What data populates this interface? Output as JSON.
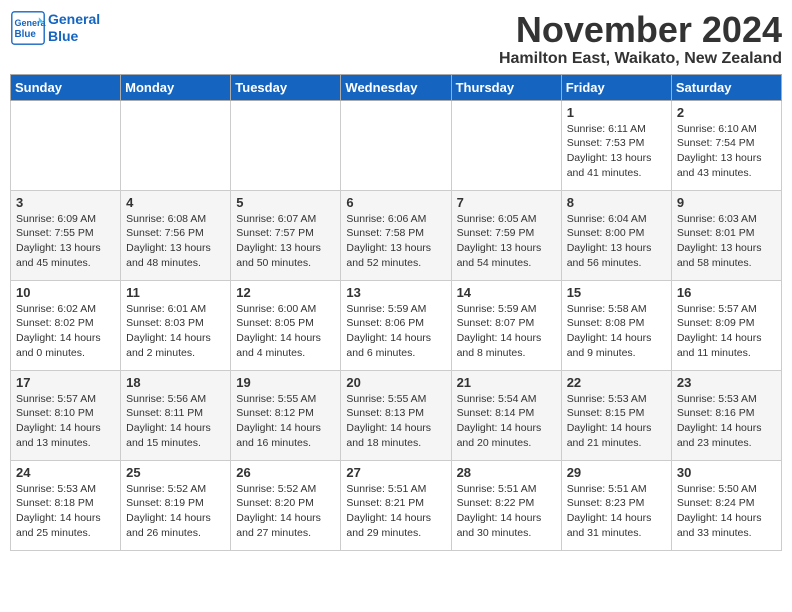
{
  "header": {
    "logo_line1": "General",
    "logo_line2": "Blue",
    "month": "November 2024",
    "location": "Hamilton East, Waikato, New Zealand"
  },
  "weekdays": [
    "Sunday",
    "Monday",
    "Tuesday",
    "Wednesday",
    "Thursday",
    "Friday",
    "Saturday"
  ],
  "weeks": [
    [
      {
        "day": "",
        "detail": ""
      },
      {
        "day": "",
        "detail": ""
      },
      {
        "day": "",
        "detail": ""
      },
      {
        "day": "",
        "detail": ""
      },
      {
        "day": "",
        "detail": ""
      },
      {
        "day": "1",
        "detail": "Sunrise: 6:11 AM\nSunset: 7:53 PM\nDaylight: 13 hours\nand 41 minutes."
      },
      {
        "day": "2",
        "detail": "Sunrise: 6:10 AM\nSunset: 7:54 PM\nDaylight: 13 hours\nand 43 minutes."
      }
    ],
    [
      {
        "day": "3",
        "detail": "Sunrise: 6:09 AM\nSunset: 7:55 PM\nDaylight: 13 hours\nand 45 minutes."
      },
      {
        "day": "4",
        "detail": "Sunrise: 6:08 AM\nSunset: 7:56 PM\nDaylight: 13 hours\nand 48 minutes."
      },
      {
        "day": "5",
        "detail": "Sunrise: 6:07 AM\nSunset: 7:57 PM\nDaylight: 13 hours\nand 50 minutes."
      },
      {
        "day": "6",
        "detail": "Sunrise: 6:06 AM\nSunset: 7:58 PM\nDaylight: 13 hours\nand 52 minutes."
      },
      {
        "day": "7",
        "detail": "Sunrise: 6:05 AM\nSunset: 7:59 PM\nDaylight: 13 hours\nand 54 minutes."
      },
      {
        "day": "8",
        "detail": "Sunrise: 6:04 AM\nSunset: 8:00 PM\nDaylight: 13 hours\nand 56 minutes."
      },
      {
        "day": "9",
        "detail": "Sunrise: 6:03 AM\nSunset: 8:01 PM\nDaylight: 13 hours\nand 58 minutes."
      }
    ],
    [
      {
        "day": "10",
        "detail": "Sunrise: 6:02 AM\nSunset: 8:02 PM\nDaylight: 14 hours\nand 0 minutes."
      },
      {
        "day": "11",
        "detail": "Sunrise: 6:01 AM\nSunset: 8:03 PM\nDaylight: 14 hours\nand 2 minutes."
      },
      {
        "day": "12",
        "detail": "Sunrise: 6:00 AM\nSunset: 8:05 PM\nDaylight: 14 hours\nand 4 minutes."
      },
      {
        "day": "13",
        "detail": "Sunrise: 5:59 AM\nSunset: 8:06 PM\nDaylight: 14 hours\nand 6 minutes."
      },
      {
        "day": "14",
        "detail": "Sunrise: 5:59 AM\nSunset: 8:07 PM\nDaylight: 14 hours\nand 8 minutes."
      },
      {
        "day": "15",
        "detail": "Sunrise: 5:58 AM\nSunset: 8:08 PM\nDaylight: 14 hours\nand 9 minutes."
      },
      {
        "day": "16",
        "detail": "Sunrise: 5:57 AM\nSunset: 8:09 PM\nDaylight: 14 hours\nand 11 minutes."
      }
    ],
    [
      {
        "day": "17",
        "detail": "Sunrise: 5:57 AM\nSunset: 8:10 PM\nDaylight: 14 hours\nand 13 minutes."
      },
      {
        "day": "18",
        "detail": "Sunrise: 5:56 AM\nSunset: 8:11 PM\nDaylight: 14 hours\nand 15 minutes."
      },
      {
        "day": "19",
        "detail": "Sunrise: 5:55 AM\nSunset: 8:12 PM\nDaylight: 14 hours\nand 16 minutes."
      },
      {
        "day": "20",
        "detail": "Sunrise: 5:55 AM\nSunset: 8:13 PM\nDaylight: 14 hours\nand 18 minutes."
      },
      {
        "day": "21",
        "detail": "Sunrise: 5:54 AM\nSunset: 8:14 PM\nDaylight: 14 hours\nand 20 minutes."
      },
      {
        "day": "22",
        "detail": "Sunrise: 5:53 AM\nSunset: 8:15 PM\nDaylight: 14 hours\nand 21 minutes."
      },
      {
        "day": "23",
        "detail": "Sunrise: 5:53 AM\nSunset: 8:16 PM\nDaylight: 14 hours\nand 23 minutes."
      }
    ],
    [
      {
        "day": "24",
        "detail": "Sunrise: 5:53 AM\nSunset: 8:18 PM\nDaylight: 14 hours\nand 25 minutes."
      },
      {
        "day": "25",
        "detail": "Sunrise: 5:52 AM\nSunset: 8:19 PM\nDaylight: 14 hours\nand 26 minutes."
      },
      {
        "day": "26",
        "detail": "Sunrise: 5:52 AM\nSunset: 8:20 PM\nDaylight: 14 hours\nand 27 minutes."
      },
      {
        "day": "27",
        "detail": "Sunrise: 5:51 AM\nSunset: 8:21 PM\nDaylight: 14 hours\nand 29 minutes."
      },
      {
        "day": "28",
        "detail": "Sunrise: 5:51 AM\nSunset: 8:22 PM\nDaylight: 14 hours\nand 30 minutes."
      },
      {
        "day": "29",
        "detail": "Sunrise: 5:51 AM\nSunset: 8:23 PM\nDaylight: 14 hours\nand 31 minutes."
      },
      {
        "day": "30",
        "detail": "Sunrise: 5:50 AM\nSunset: 8:24 PM\nDaylight: 14 hours\nand 33 minutes."
      }
    ]
  ]
}
